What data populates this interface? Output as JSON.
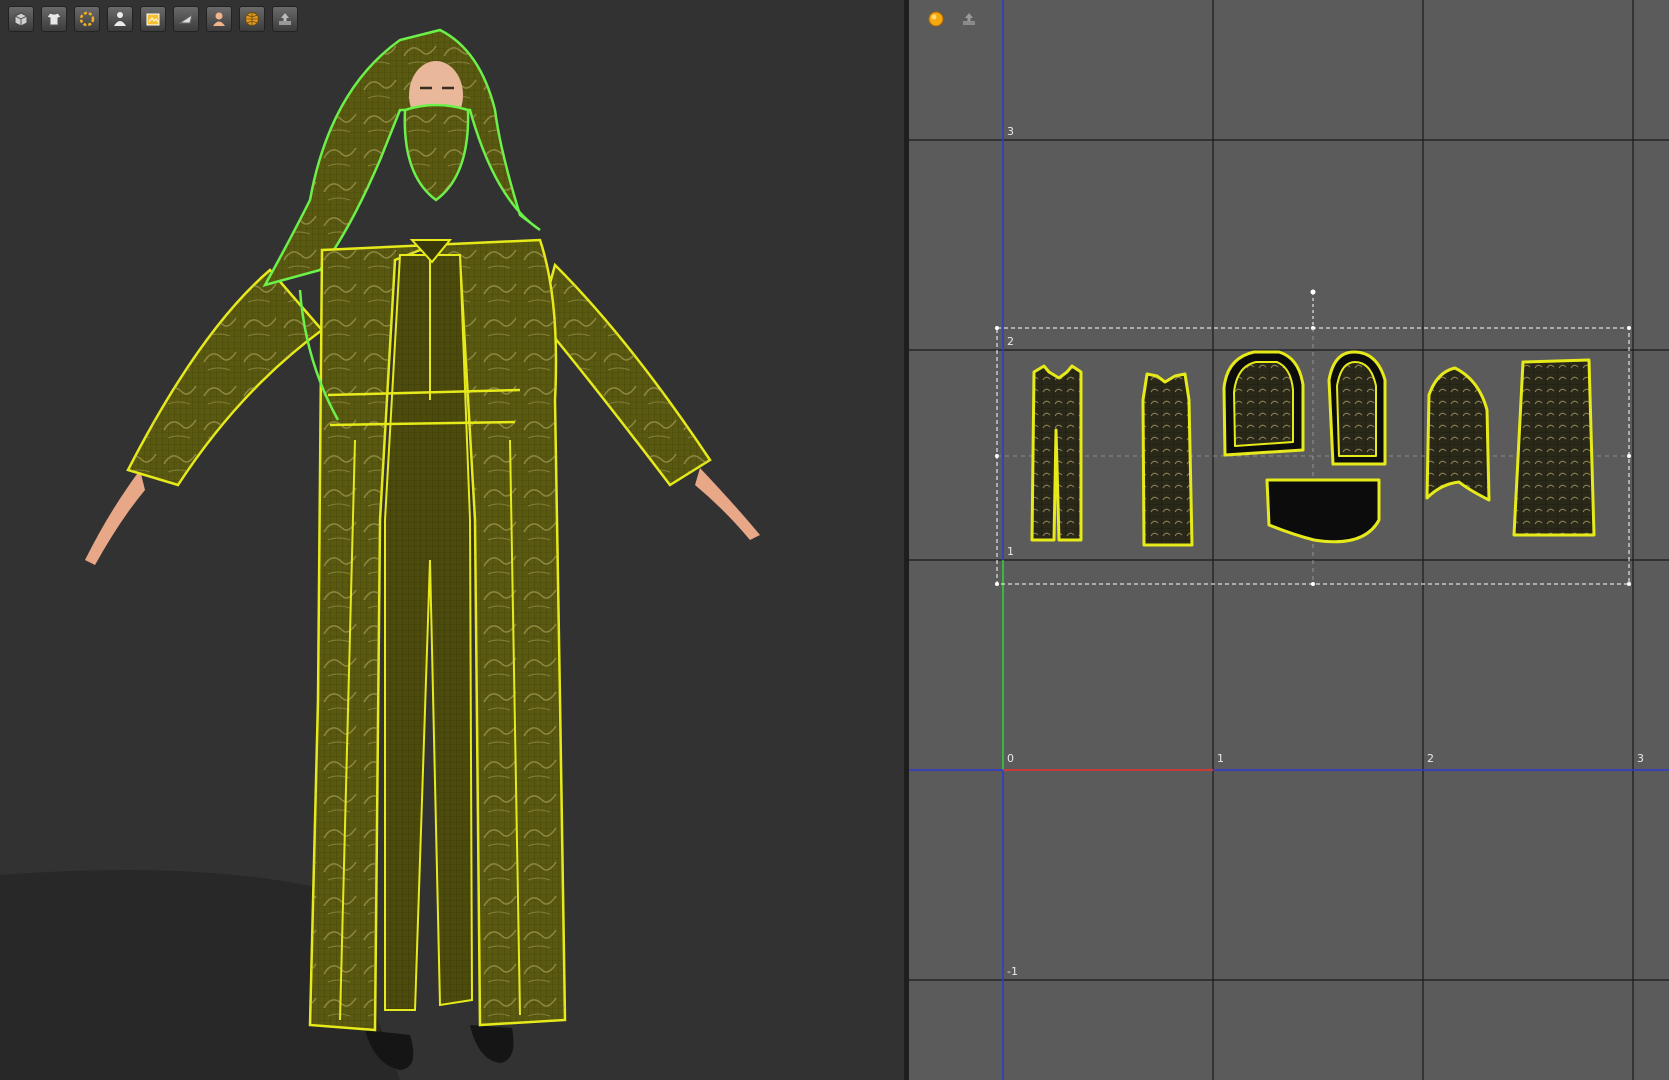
{
  "viewport3d": {
    "toolbar": [
      {
        "icon": "cube-icon"
      },
      {
        "icon": "garment-icon"
      },
      {
        "icon": "sewing-icon"
      },
      {
        "icon": "avatar-icon"
      },
      {
        "icon": "texture-icon"
      },
      {
        "icon": "fold-icon"
      },
      {
        "icon": "skin-icon"
      },
      {
        "icon": "grid-sphere-icon"
      },
      {
        "icon": "export-icon"
      }
    ]
  },
  "viewport2d": {
    "toolbar": [
      {
        "icon": "sphere-icon"
      },
      {
        "icon": "export-icon"
      }
    ],
    "grid": {
      "x_labels": [
        "0",
        "1",
        "2",
        "3"
      ],
      "y_labels": [
        "3",
        "2",
        "1",
        "-1"
      ]
    }
  },
  "colors": {
    "seam": "#e6ea1a",
    "seam_selected": "#6cf04a",
    "fabric": "#5d5c12",
    "grid_bg": "#5b5b5b",
    "grid_line": "#1b1b1b",
    "axis_x": "#c63b3b",
    "axis_y": "#2e39d6",
    "axis_green": "#2ed63a"
  }
}
